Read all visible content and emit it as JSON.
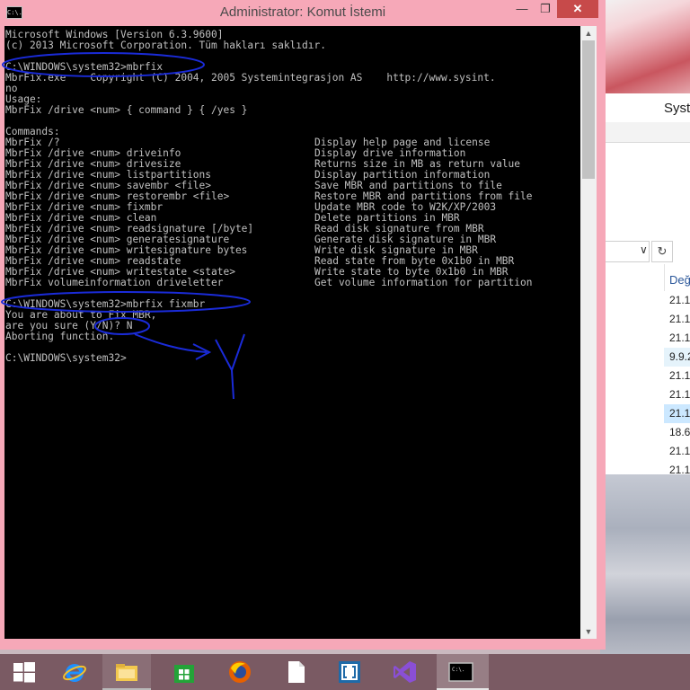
{
  "cmd_window": {
    "title": "Administrator: Komut İstemi",
    "icon_text": "C:\\.",
    "controls": {
      "minimize": "—",
      "maximize": "❐",
      "close": "✕"
    }
  },
  "console": {
    "lines": [
      "Microsoft Windows [Version 6.3.9600]",
      "(c) 2013 Microsoft Corporation. Tüm hakları saklıdır.",
      "",
      "C:\\WINDOWS\\system32>mbrfix",
      "MbrFix.exe    Copyright (C) 2004, 2005 Systemintegrasjon AS    http://www.sysint.",
      "no",
      "Usage:",
      "MbrFix /drive <num> { command } { /yes }",
      "",
      "Commands:",
      "MbrFix /?",
      "MbrFix /drive <num> driveinfo",
      "MbrFix /drive <num> drivesize",
      "MbrFix /drive <num> listpartitions",
      "MbrFix /drive <num> savembr <file>",
      "MbrFix /drive <num> restorembr <file>",
      "MbrFix /drive <num> fixmbr",
      "MbrFix /drive <num> clean",
      "MbrFix /drive <num> readsignature [/byte]",
      "MbrFix /drive <num> generatesignature",
      "MbrFix /drive <num> writesignature bytes",
      "MbrFix /drive <num> readstate",
      "MbrFix /drive <num> writestate <state>",
      "MbrFix volumeinformation driveletter",
      "",
      "C:\\WINDOWS\\system32>mbrfix fixmbr",
      "You are about to Fix MBR,",
      "are you sure (Y/N)? N",
      "Aborting function.",
      "",
      "C:\\WINDOWS\\system32>"
    ],
    "descriptions": [
      "Display help page and license",
      "Display drive information",
      "Returns size in MB as return value",
      "Display partition information",
      "Save MBR and partitions to file",
      "Restore MBR and partitions from file",
      "Update MBR code to W2K/XP/2003",
      "Delete partitions in MBR",
      "Read disk signature from MBR",
      "Generate disk signature in MBR",
      "Write disk signature in MBR",
      "Read state from byte 0x1b0 in MBR",
      "Write state to byte 0x1b0 in MBR",
      "Get volume information for partition"
    ],
    "annotation_letter": "Y"
  },
  "scrollbar": {
    "up": "▲",
    "down": "▼"
  },
  "explorer": {
    "title": "Syste",
    "address_chevron": "∨",
    "refresh": "↻",
    "column_header": "Değ",
    "rows": [
      "21.1",
      "21.1",
      "21.1",
      "9.9.2",
      "21.1",
      "21.1",
      "21.1",
      "18.6",
      "21.1",
      "21.1",
      "21.1",
      "21.1"
    ]
  },
  "taskbar": {
    "items": [
      {
        "name": "start",
        "icon": "windows-logo-icon"
      },
      {
        "name": "internet-explorer",
        "icon": "internet-explorer-icon"
      },
      {
        "name": "file-explorer",
        "icon": "folder-icon"
      },
      {
        "name": "store",
        "icon": "store-icon"
      },
      {
        "name": "firefox",
        "icon": "firefox-icon"
      },
      {
        "name": "blank-document",
        "icon": "document-icon"
      },
      {
        "name": "brackets",
        "icon": "brackets-icon"
      },
      {
        "name": "visual-studio",
        "icon": "visual-studio-icon"
      },
      {
        "name": "command-prompt",
        "icon": "command-prompt-icon"
      }
    ],
    "cmd_icon_text": "C:\\."
  },
  "colors": {
    "titlebar": "#f6a8b8",
    "console_bg": "#000000",
    "console_text": "#c0c0c0",
    "annotation": "#1a2bd8",
    "taskbar": "#7a5a63",
    "close_button": "#c74a4a"
  }
}
